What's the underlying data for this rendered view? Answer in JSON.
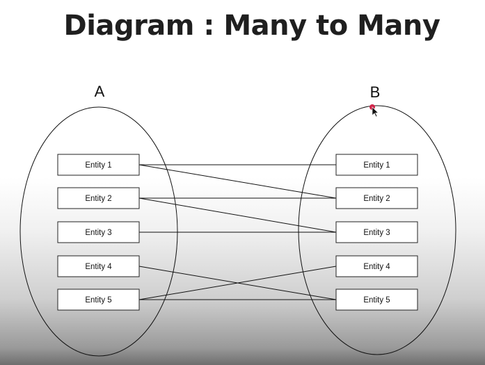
{
  "title": "Diagram : Many to Many",
  "set_a": {
    "label": "A",
    "entities": [
      "Entity 1",
      "Entity 2",
      "Entity 3",
      "Entity 4",
      "Entity 5"
    ]
  },
  "set_b": {
    "label": "B",
    "entities": [
      "Entity 1",
      "Entity 2",
      "Entity 3",
      "Entity 4",
      "Entity 5"
    ]
  },
  "relationships": [
    {
      "from": 1,
      "to": 1
    },
    {
      "from": 1,
      "to": 2
    },
    {
      "from": 2,
      "to": 2
    },
    {
      "from": 2,
      "to": 3
    },
    {
      "from": 3,
      "to": 3
    },
    {
      "from": 4,
      "to": 5
    },
    {
      "from": 5,
      "to": 4
    },
    {
      "from": 5,
      "to": 5
    }
  ],
  "colors": {
    "stroke": "#111111",
    "cursor_dot": "#d0254a"
  }
}
